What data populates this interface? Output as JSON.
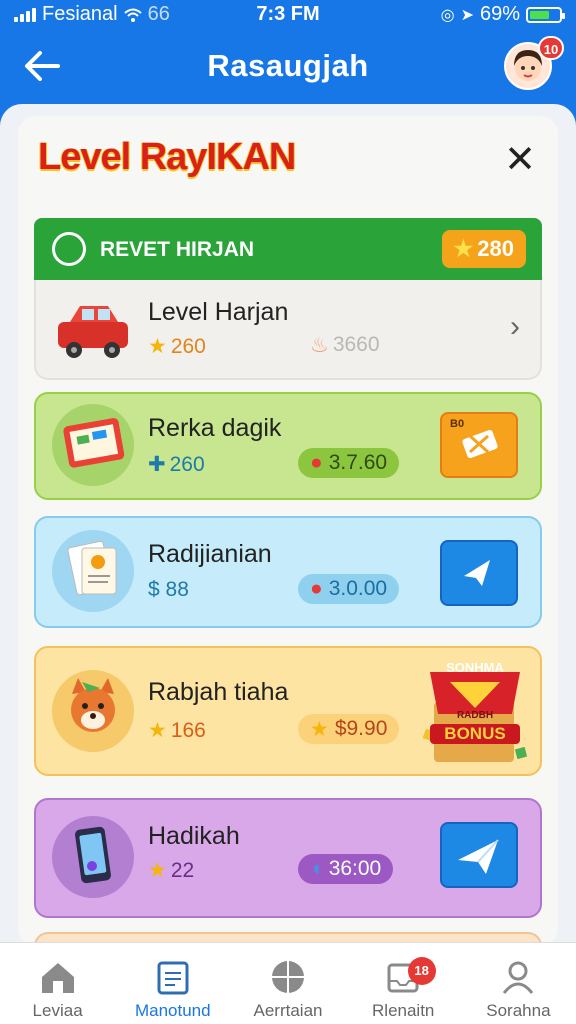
{
  "status_bar": {
    "carrier": "Fesianal",
    "network": "66",
    "time": "7:3 FM",
    "battery": "69%",
    "battery_level": 0.69
  },
  "header": {
    "title": "Rasaugjah",
    "avatar_badge": "10"
  },
  "panel": {
    "title": "Level RayIKAN",
    "section": {
      "label": "REVET HIRJAN",
      "points": "280"
    },
    "items": [
      {
        "name": "Level Harjan",
        "sub": "260",
        "value": "3660",
        "icon": "car-icon",
        "action": "chevron-right-icon"
      },
      {
        "name": "Rerka dagik",
        "sub": "260",
        "value": "3.7.60",
        "icon": "board-icon",
        "action_badge": "B0"
      },
      {
        "name": "Radijianian",
        "sub": "$ 88",
        "value": "3.0.00",
        "icon": "document-icon"
      },
      {
        "name": "Rabjah tiaha",
        "sub": "166",
        "value": "$9.90",
        "icon": "fox-icon",
        "bonus_top": "SONHMA",
        "bonus_mid": "RADBH",
        "bonus_bottom": "BONUS"
      },
      {
        "name": "Hadikah",
        "sub": "22",
        "value": "36:00",
        "icon": "phone-icon"
      }
    ]
  },
  "bottom_nav": [
    {
      "label": "Leviaa",
      "icon": "home-icon"
    },
    {
      "label": "Manotund",
      "icon": "calendar-icon",
      "active": true
    },
    {
      "label": "Aerrtaian",
      "icon": "globe-icon"
    },
    {
      "label": "Rlenaitn",
      "icon": "inbox-icon",
      "badge": "18"
    },
    {
      "label": "Sorahna",
      "icon": "user-icon"
    }
  ],
  "colors": {
    "header_blue": "#1877e6",
    "title_red": "#d9211a",
    "green": "#2aa339",
    "gold": "#f6a31c"
  }
}
